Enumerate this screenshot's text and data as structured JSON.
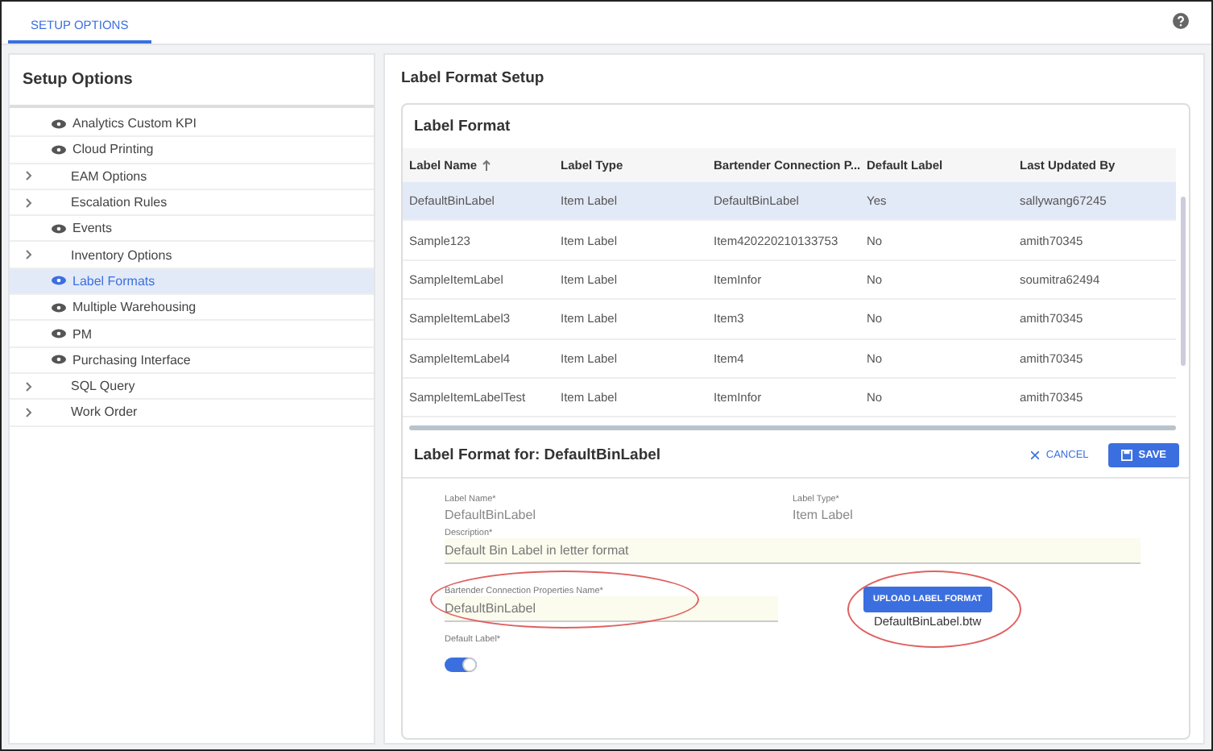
{
  "top_bar": {
    "tabs": [
      {
        "label": "SETUP OPTIONS",
        "selected": true
      }
    ]
  },
  "sidebar": {
    "title": "Setup Options",
    "items": [
      {
        "label": "Analytics Custom KPI",
        "kind": "page",
        "selected": false
      },
      {
        "label": "Cloud Printing",
        "kind": "page",
        "selected": false
      },
      {
        "label": "EAM Options",
        "kind": "group",
        "selected": false
      },
      {
        "label": "Escalation Rules",
        "kind": "group",
        "selected": false
      },
      {
        "label": "Events",
        "kind": "page",
        "selected": false
      },
      {
        "label": "Inventory Options",
        "kind": "group",
        "selected": false
      },
      {
        "label": "Label Formats",
        "kind": "page",
        "selected": true
      },
      {
        "label": "Multiple Warehousing",
        "kind": "page",
        "selected": false
      },
      {
        "label": "PM",
        "kind": "page",
        "selected": false
      },
      {
        "label": "Purchasing Interface",
        "kind": "page",
        "selected": false
      },
      {
        "label": "SQL Query",
        "kind": "group",
        "selected": false
      },
      {
        "label": "Work Order",
        "kind": "group",
        "selected": false
      }
    ]
  },
  "main": {
    "title": "Label Format Setup",
    "table": {
      "title": "Label Format",
      "columns": [
        {
          "label": "Label Name",
          "sorted": true
        },
        {
          "label": "Label Type",
          "sorted": false
        },
        {
          "label": "Bartender Connection P...",
          "sorted": false
        },
        {
          "label": "Default Label",
          "sorted": false
        },
        {
          "label": "Last Updated By",
          "sorted": false
        }
      ],
      "rows": [
        {
          "selected": true,
          "cells": [
            "DefaultBinLabel",
            "Item Label",
            "DefaultBinLabel",
            "Yes",
            "sallywang67245"
          ]
        },
        {
          "selected": false,
          "cells": [
            "Sample123",
            "Item Label",
            "Item420220210133753",
            "No",
            "amith70345"
          ]
        },
        {
          "selected": false,
          "cells": [
            "SampleItemLabel",
            "Item Label",
            "ItemInfor",
            "No",
            "soumitra62494"
          ]
        },
        {
          "selected": false,
          "cells": [
            "SampleItemLabel3",
            "Item Label",
            "Item3",
            "No",
            "amith70345"
          ]
        },
        {
          "selected": false,
          "cells": [
            "SampleItemLabel4",
            "Item Label",
            "Item4",
            "No",
            "amith70345"
          ]
        },
        {
          "selected": false,
          "cells": [
            "SampleItemLabelTest",
            "Item Label",
            "ItemInfor",
            "No",
            "amith70345"
          ]
        }
      ]
    },
    "detail": {
      "title": "Label Format for: DefaultBinLabel",
      "cancel": "CANCEL",
      "save": "SAVE",
      "label_name": {
        "label": "Label Name*",
        "value": "DefaultBinLabel"
      },
      "label_type": {
        "label": "Label Type*",
        "value": "Item Label"
      },
      "description": {
        "label": "Description*",
        "value": "Default Bin Label in letter format"
      },
      "bartender_name": {
        "label": "Bartender Connection Properties Name*",
        "value": "DefaultBinLabel",
        "circled": true
      },
      "upload": {
        "label": "UPLOAD LABEL FORMAT",
        "file": "DefaultBinLabel.btw",
        "circled": true
      },
      "default_label": {
        "label": "Default Label*",
        "on": true
      }
    }
  }
}
